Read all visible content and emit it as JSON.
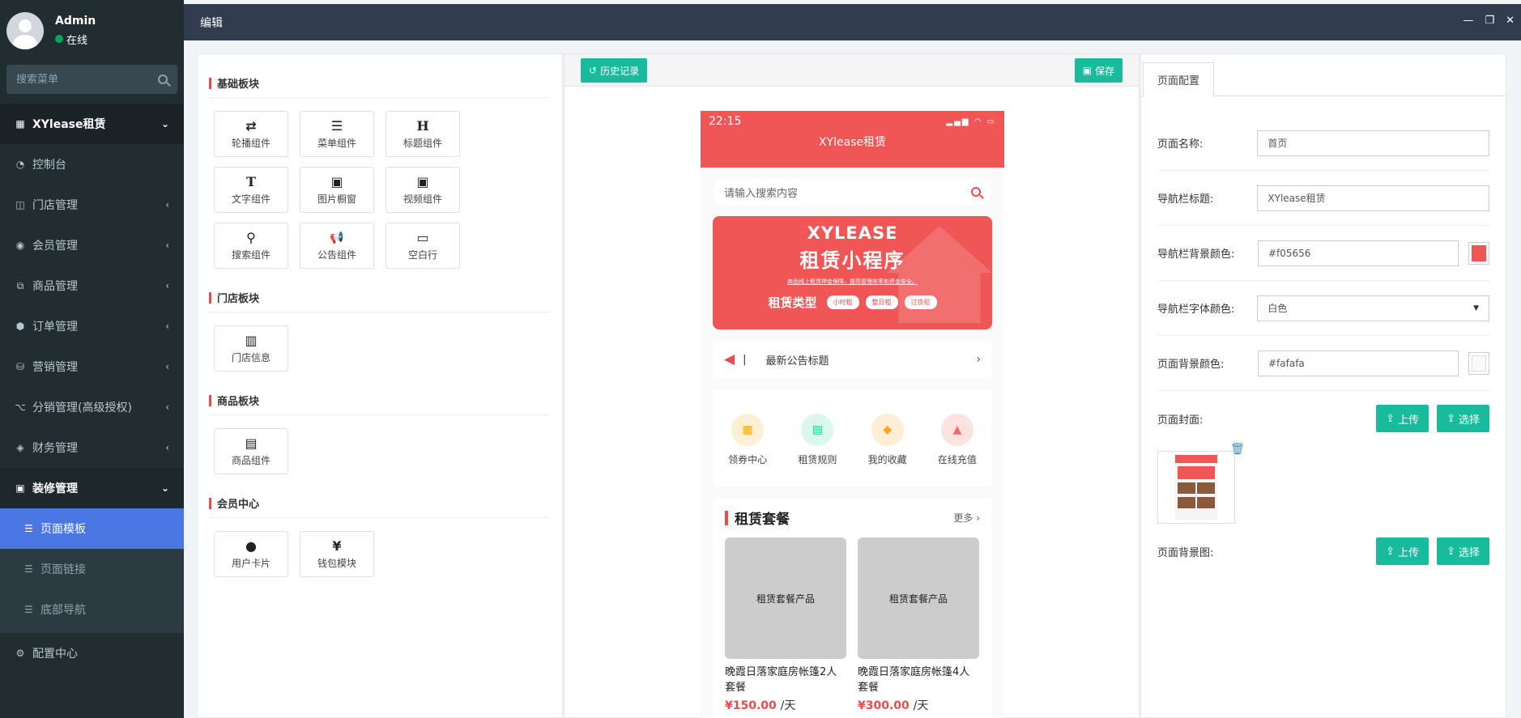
{
  "user": {
    "name": "Admin",
    "status": "在线"
  },
  "sidebar": {
    "search_placeholder": "搜索菜单",
    "header": "XYlease租赁",
    "items": [
      {
        "label": "控制台",
        "icon": "dashboard-icon"
      },
      {
        "label": "门店管理",
        "icon": "store-icon"
      },
      {
        "label": "会员管理",
        "icon": "user-circle-icon"
      },
      {
        "label": "商品管理",
        "icon": "goods-icon"
      },
      {
        "label": "订单管理",
        "icon": "order-icon"
      },
      {
        "label": "营销管理",
        "icon": "marketing-icon"
      },
      {
        "label": "分销管理(高级授权)",
        "icon": "sitemap-icon"
      },
      {
        "label": "财务管理",
        "icon": "diamond-icon"
      }
    ],
    "open_group": "装修管理",
    "sub_items": [
      "页面模板",
      "页面链接",
      "底部导航"
    ],
    "last_item": "配置中心"
  },
  "topbar": {
    "title": "编辑"
  },
  "blocks": {
    "basic_title": "基础板块",
    "basic": [
      {
        "label": "轮播组件",
        "glyph": "⇄"
      },
      {
        "label": "菜单组件",
        "glyph": "☰"
      },
      {
        "label": "标题组件",
        "glyph": "H"
      },
      {
        "label": "文字组件",
        "glyph": "T"
      },
      {
        "label": "图片橱窗",
        "glyph": "▣"
      },
      {
        "label": "视频组件",
        "glyph": "▣"
      },
      {
        "label": "搜索组件",
        "glyph": "⚲"
      },
      {
        "label": "公告组件",
        "glyph": "📢"
      },
      {
        "label": "空白行",
        "glyph": "▭"
      }
    ],
    "store_title": "门店板块",
    "store": [
      {
        "label": "门店信息",
        "glyph": "▥"
      }
    ],
    "goods_title": "商品板块",
    "goods": [
      {
        "label": "商品组件",
        "glyph": "▤"
      }
    ],
    "member_title": "会员中心",
    "member": [
      {
        "label": "用户卡片",
        "glyph": "●"
      },
      {
        "label": "钱包模块",
        "glyph": "¥"
      }
    ]
  },
  "toolbar": {
    "history": "历史记录",
    "save": "保存"
  },
  "phone": {
    "time": "22:15",
    "title": "XYlease租赁",
    "search_placeholder": "请输入搜索内容",
    "banner": {
      "line1": "XYLEASE",
      "line2": "租赁小程序",
      "line3": "商品线上租赁押金保障，提高管理效率和资金安全。",
      "type_label": "租赁类型",
      "pills": [
        "小时租",
        "整日租",
        "过夜租"
      ]
    },
    "notice": {
      "sep": "|",
      "text": "最新公告标题"
    },
    "iconnav": [
      {
        "label": "领券中心",
        "bg": "#fdf0d5",
        "fg": "#f5a623"
      },
      {
        "label": "租赁规则",
        "bg": "#dcf7ec",
        "fg": "#2fcf8c"
      },
      {
        "label": "我的收藏",
        "bg": "#fdeed5",
        "fg": "#f5a623"
      },
      {
        "label": "在线充值",
        "bg": "#fde2e2",
        "fg": "#f06a6a"
      }
    ],
    "package": {
      "title": "租赁套餐",
      "more": "更多",
      "items": [
        {
          "img": "租赁套餐产品",
          "name": "晚霞日落家庭房帐篷2人套餐",
          "price": "¥150.00",
          "unit": "/天"
        },
        {
          "img": "租赁套餐产品",
          "name": "晚霞日落家庭房帐篷4人套餐",
          "price": "¥300.00",
          "unit": "/天"
        }
      ]
    }
  },
  "config": {
    "tab": "页面配置",
    "page_name_label": "页面名称:",
    "page_name": "首页",
    "nav_title_label": "导航栏标题:",
    "nav_title": "XYlease租赁",
    "nav_bg_label": "导航栏背景颜色:",
    "nav_bg": "#f05656",
    "nav_font_label": "导航栏字体颜色:",
    "nav_font": "白色",
    "page_bg_label": "页面背景颜色:",
    "page_bg": "#fafafa",
    "cover_label": "页面封面:",
    "bgimg_label": "页面背景图:",
    "upload": "上传",
    "choose": "选择"
  }
}
